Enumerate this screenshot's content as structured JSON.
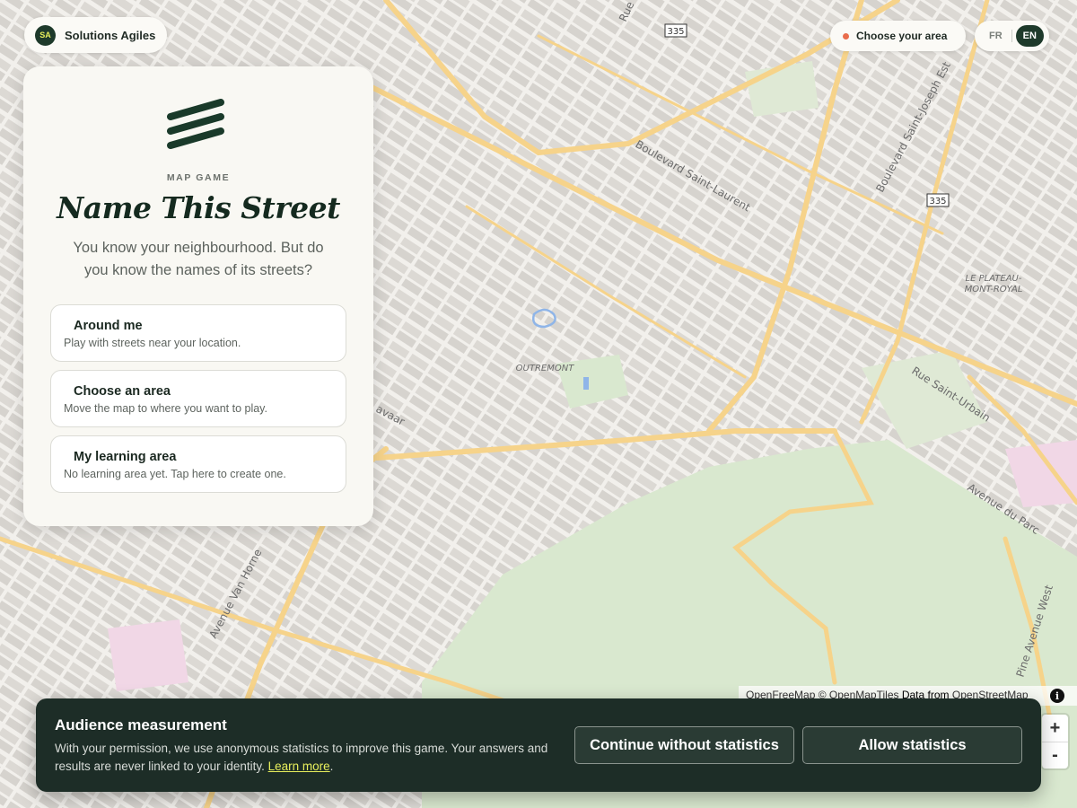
{
  "brand": {
    "initials": "SA",
    "name": "Solutions Agiles"
  },
  "top_controls": {
    "area_button": "Choose your area",
    "languages": [
      "FR",
      "EN"
    ],
    "active_language": "EN"
  },
  "map": {
    "labels": [
      "Boulevard Saint-Laurent",
      "Boulevard Saint-Joseph Est",
      "LE PLATEAU-",
      "MONT-ROYAL",
      "OUTREMONT",
      "Rue Saint-Urbain",
      "Avenue du Parc",
      "Avenue Van Horne",
      "Pine Avenue West",
      "Rue",
      "avaar",
      "335",
      "335"
    ],
    "attribution": {
      "openfreemap": "OpenFreeMap",
      "copyright": "©",
      "openmaptiles": "OpenMapTiles",
      "data_from": "Data from",
      "osm": "OpenStreetMap"
    },
    "zoom_in": "+",
    "zoom_out": "-",
    "info_icon": "i"
  },
  "panel": {
    "kicker": "MAP GAME",
    "title": "Name This Street",
    "subtitle": "You know your neighbourhood. But do you know the names of its streets?",
    "options": [
      {
        "title": "Around me",
        "description": "Play with streets near your location."
      },
      {
        "title": "Choose an area",
        "description": "Move the map to where you want to play."
      },
      {
        "title": "My learning area",
        "description": "No learning area yet. Tap here to create one."
      }
    ]
  },
  "consent": {
    "title": "Audience measurement",
    "body": "With your permission, we use anonymous statistics to improve this game. Your answers and results are never linked to your identity.",
    "link": "Learn more",
    "link_suffix": ".",
    "decline": "Continue without statistics",
    "accept": "Allow statistics"
  },
  "colors": {
    "accent_dark": "#1e3a2b",
    "accent_lime": "#e8ef5c",
    "status_dot": "#e96d4c",
    "consent_bg": "#1d2d27",
    "park": "#d9e8cf",
    "road": "#f6d38a"
  }
}
